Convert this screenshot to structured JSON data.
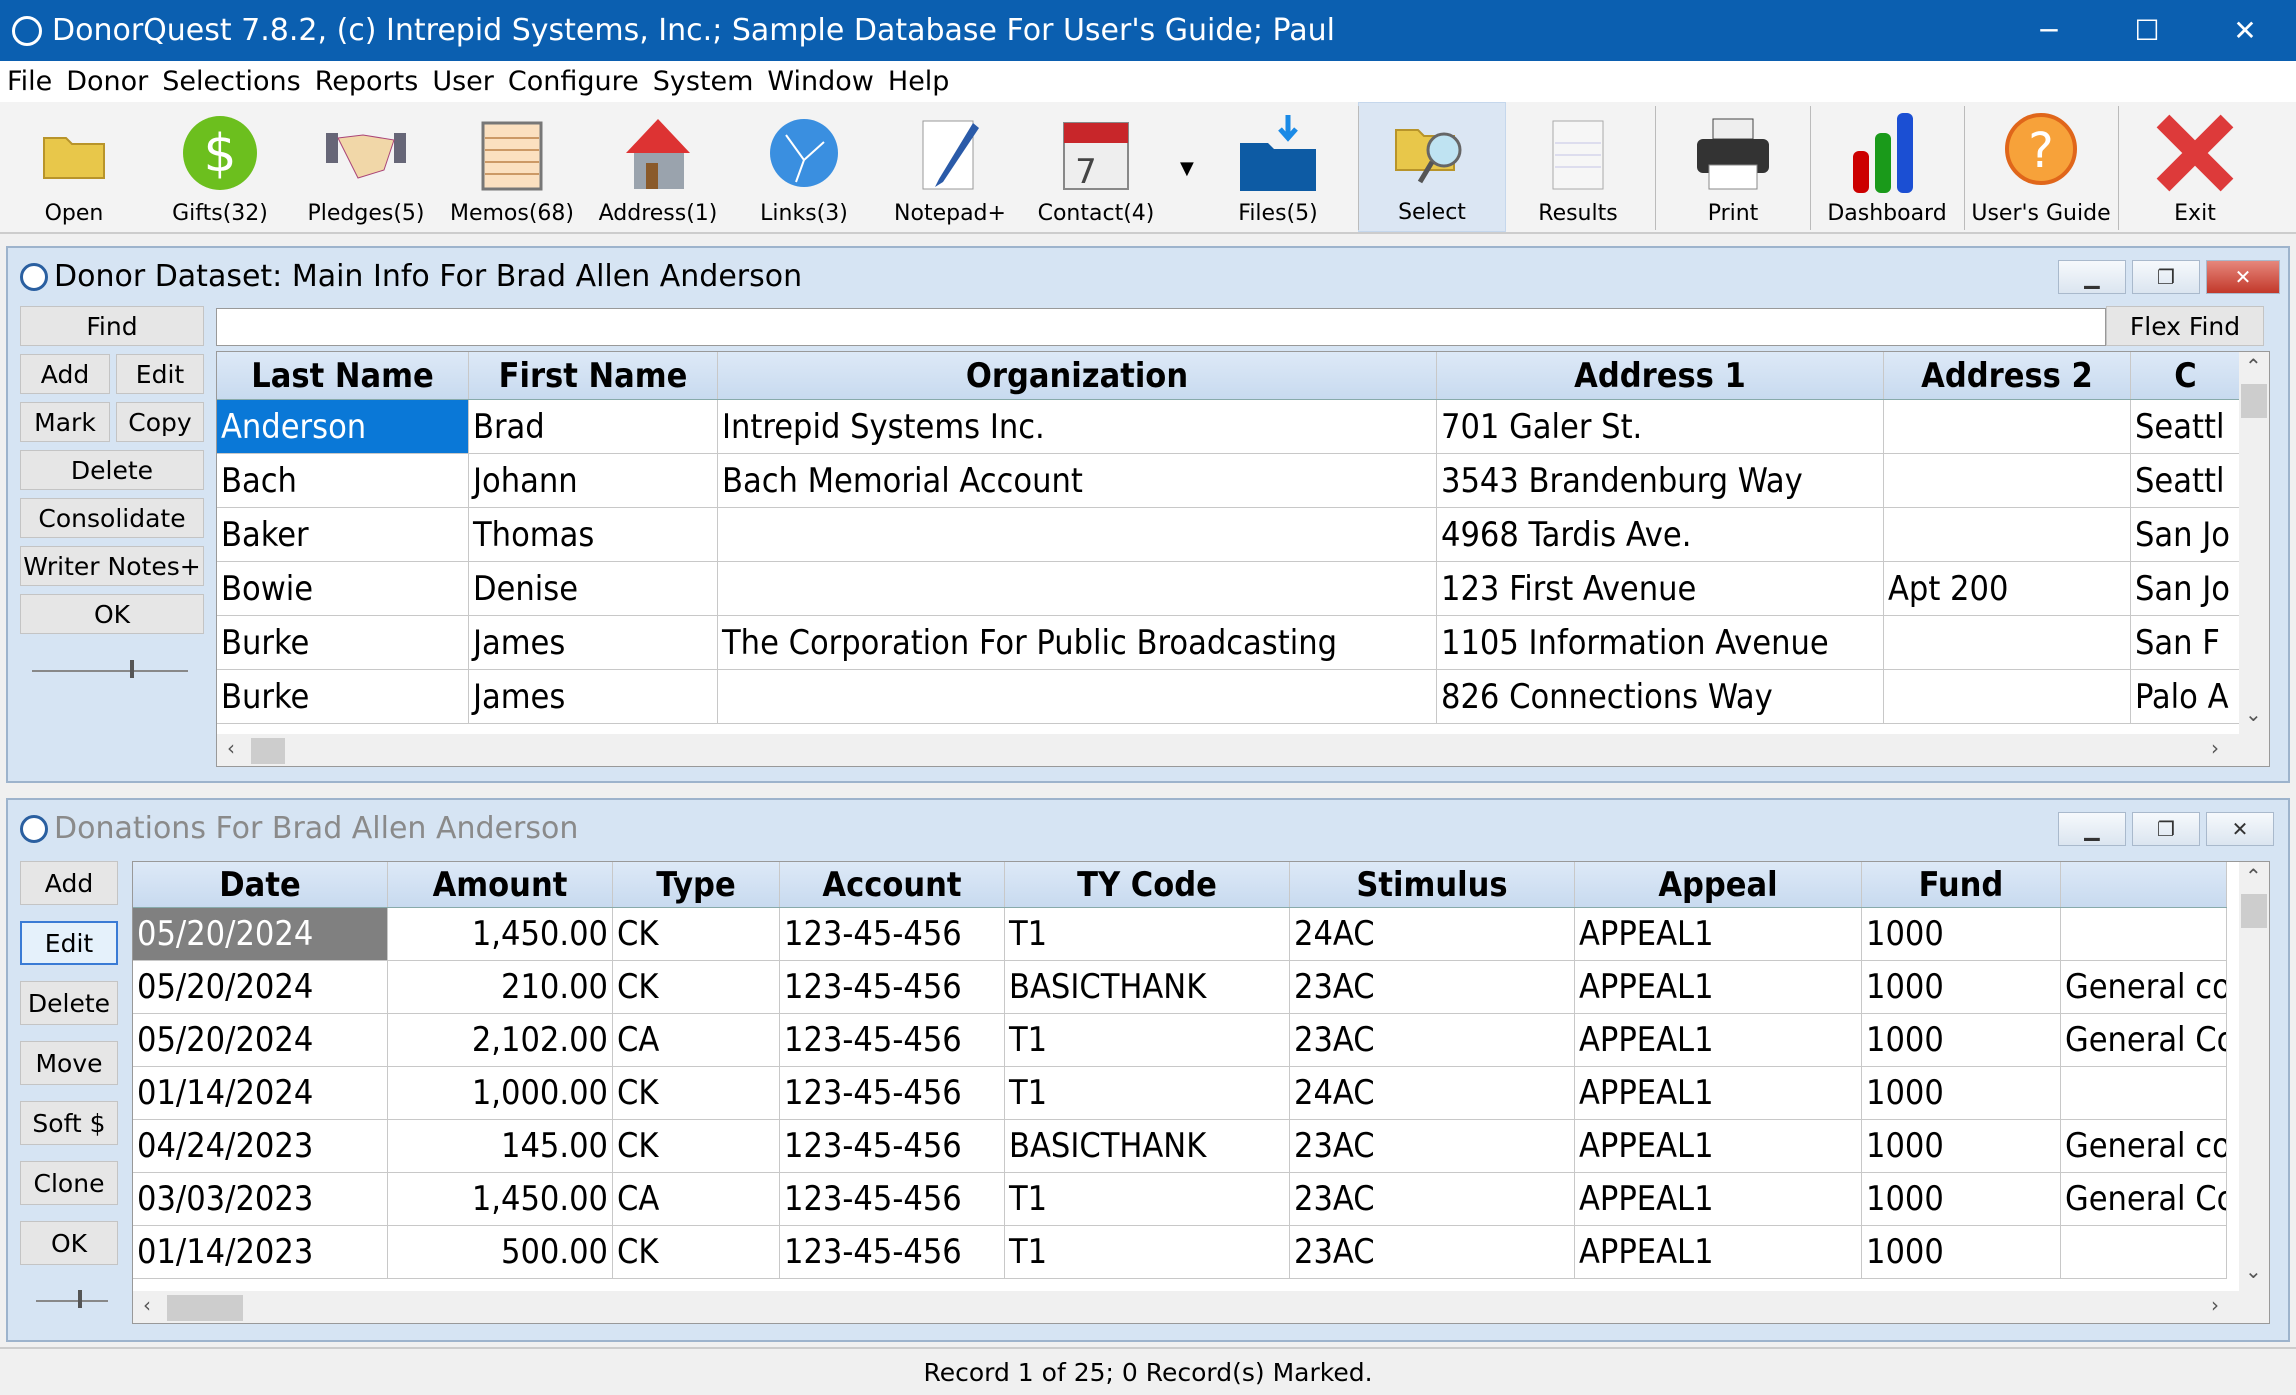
{
  "window": {
    "title": "DonorQuest 7.8.2, (c) Intrepid Systems, Inc.; Sample Database For User's Guide; Paul",
    "minimize": "─",
    "maximize": "☐",
    "close": "✕"
  },
  "menu": [
    "File",
    "Donor",
    "Selections",
    "Reports",
    "User",
    "Configure",
    "System",
    "Window",
    "Help"
  ],
  "toolbar": [
    {
      "label": "Open",
      "icon": "folder-icon"
    },
    {
      "label": "Gifts(32)",
      "icon": "dollar-icon"
    },
    {
      "label": "Pledges(5)",
      "icon": "handshake-icon"
    },
    {
      "label": "Memos(68)",
      "icon": "memo-icon"
    },
    {
      "label": "Address(1)",
      "icon": "house-icon"
    },
    {
      "label": "Links(3)",
      "icon": "globe-icon"
    },
    {
      "label": "Notepad+",
      "icon": "notepad-icon"
    },
    {
      "label": "Contact(4)",
      "icon": "calendar-icon"
    },
    {
      "label": "Files(5)",
      "icon": "files-icon"
    },
    {
      "label": "Select",
      "icon": "select-icon"
    },
    {
      "label": "Results",
      "icon": "results-icon"
    },
    {
      "label": "Print",
      "icon": "printer-icon"
    },
    {
      "label": "Dashboard",
      "icon": "chart-icon"
    },
    {
      "label": "User's Guide",
      "icon": "help-icon"
    },
    {
      "label": "Exit",
      "icon": "exit-icon"
    }
  ],
  "donor": {
    "title": "Donor Dataset: Main Info For Brad Allen Anderson",
    "find": "Find",
    "flex_find": "Flex Find",
    "search_value": "",
    "buttons": [
      "Add",
      "Edit",
      "Mark",
      "Copy",
      "Delete",
      "Consolidate",
      "Writer Notes+",
      "OK"
    ],
    "columns": [
      "Last Name",
      "First Name",
      "Organization",
      "Address 1",
      "Address 2",
      "C"
    ],
    "rows": [
      [
        "Anderson",
        "Brad",
        "Intrepid Systems Inc.",
        "701 Galer St.",
        "",
        "Seattl"
      ],
      [
        "Bach",
        "Johann",
        "Bach Memorial Account",
        "3543 Brandenburg Way",
        "",
        "Seattl"
      ],
      [
        "Baker",
        "Thomas",
        "",
        "4968 Tardis Ave.",
        "",
        "San Jo"
      ],
      [
        "Bowie",
        "Denise",
        "",
        "123 First Avenue",
        "Apt 200",
        "San Jo"
      ],
      [
        "Burke",
        "James",
        "The Corporation For Public Broadcasting",
        "1105 Information Avenue",
        "",
        "San F"
      ],
      [
        "Burke",
        "James",
        "",
        "826 Connections Way",
        "",
        "Palo A"
      ]
    ]
  },
  "donations": {
    "title": "Donations For Brad Allen Anderson",
    "buttons": [
      "Add",
      "Edit",
      "Delete",
      "Move",
      "Soft $",
      "Clone",
      "OK"
    ],
    "columns": [
      "Date",
      "Amount",
      "Type",
      "Account",
      "TY Code",
      "Stimulus",
      "Appeal",
      "Fund",
      ""
    ],
    "rows": [
      [
        "05/20/2024",
        "1,450.00",
        "CK",
        "123-45-456",
        "T1",
        "24AC",
        "APPEAL1",
        "1000",
        ""
      ],
      [
        "05/20/2024",
        "210.00",
        "CK",
        "123-45-456",
        "BASICTHANK",
        "23AC",
        "APPEAL1",
        "1000",
        "General co"
      ],
      [
        "05/20/2024",
        "2,102.00",
        "CA",
        "123-45-456",
        "T1",
        "23AC",
        "APPEAL1",
        "1000",
        "General Co"
      ],
      [
        "01/14/2024",
        "1,000.00",
        "CK",
        "123-45-456",
        "T1",
        "24AC",
        "APPEAL1",
        "1000",
        ""
      ],
      [
        "04/24/2023",
        "145.00",
        "CK",
        "123-45-456",
        "BASICTHANK",
        "23AC",
        "APPEAL1",
        "1000",
        "General co"
      ],
      [
        "03/03/2023",
        "1,450.00",
        "CA",
        "123-45-456",
        "T1",
        "23AC",
        "APPEAL1",
        "1000",
        "General Co"
      ],
      [
        "01/14/2023",
        "500.00",
        "CK",
        "123-45-456",
        "T1",
        "23AC",
        "APPEAL1",
        "1000",
        ""
      ]
    ]
  },
  "status": "Record 1 of 25; 0 Record(s) Marked."
}
